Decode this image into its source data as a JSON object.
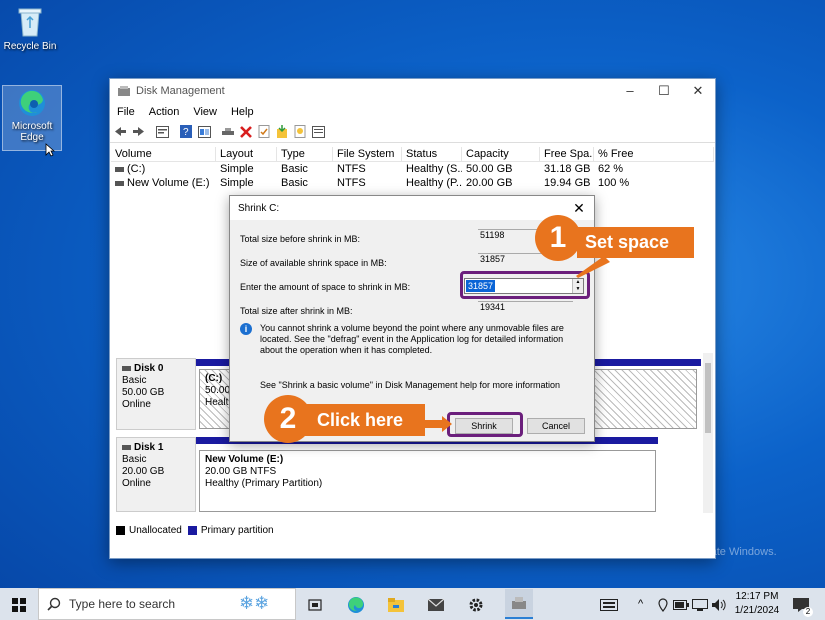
{
  "desktop": {
    "recycle_bin": "Recycle Bin",
    "edge_line1": "Microsoft",
    "edge_line2": "Edge"
  },
  "window": {
    "title": "Disk Management",
    "controls": {
      "minimize": "–",
      "maximize": "☐",
      "close": "✕"
    },
    "menu": [
      "File",
      "Action",
      "View",
      "Help"
    ],
    "toolbar_icons": [
      "back-icon",
      "forward-icon",
      "properties-icon",
      "help-icon",
      "console-icon",
      "connect-icon",
      "delete-icon",
      "check-icon",
      "import-icon",
      "search-icon",
      "list-icon"
    ]
  },
  "volume_table": {
    "headers": [
      "Volume",
      "Layout",
      "Type",
      "File System",
      "Status",
      "Capacity",
      "Free Spa...",
      "% Free"
    ],
    "rows": [
      [
        "(C:)",
        "Simple",
        "Basic",
        "NTFS",
        "Healthy (S...",
        "50.00 GB",
        "31.18 GB",
        "62 %"
      ],
      [
        "New Volume (E:)",
        "Simple",
        "Basic",
        "NTFS",
        "Healthy (P...",
        "20.00 GB",
        "19.94 GB",
        "100 %"
      ]
    ]
  },
  "disks": {
    "disk0": {
      "name": "Disk 0",
      "type": "Basic",
      "size": "50.00 GB",
      "state": "Online",
      "part_name": "(C:)",
      "part_size": "50.00 G",
      "part_status": "Healthy"
    },
    "disk1": {
      "name": "Disk 1",
      "type": "Basic",
      "size": "20.00 GB",
      "state": "Online",
      "part_name": "New Volume  (E:)",
      "part_size": "20.00 GB NTFS",
      "part_status": "Healthy (Primary Partition)"
    }
  },
  "legend": {
    "unallocated": "Unallocated",
    "primary": "Primary partition",
    "unallocated_color": "#000000",
    "primary_color": "#1a1aa0"
  },
  "dialog": {
    "title": "Shrink C:",
    "total_before_label": "Total size before shrink in MB:",
    "total_before_value": "51198",
    "available_label": "Size of available shrink space in MB:",
    "available_value": "31857",
    "enter_label": "Enter the amount of space to shrink in MB:",
    "enter_value": "31857",
    "after_label": "Total size after shrink in MB:",
    "after_value": "19341",
    "info_text": "You cannot shrink a volume beyond the point where any unmovable files are located. See the \"defrag\" event in the Application log for detailed information about the operation when it has completed.",
    "help_text": "See \"Shrink a basic volume\" in Disk Management help for more information",
    "shrink_button": "Shrink",
    "cancel_button": "Cancel"
  },
  "annotations": {
    "step1_number": "1",
    "step1_text": "Set space",
    "step2_number": "2",
    "step2_text": "Click here",
    "highlight_color": "#6b1f7c",
    "callout_color": "#e8741e"
  },
  "watermark": {
    "line1": "Activate Windows",
    "line2": "Go to Settings to activate Windows."
  },
  "taskbar": {
    "search_placeholder": "Type here to search",
    "time": "12:17 PM",
    "date": "1/21/2024",
    "notification_count": "2",
    "tray_expand": "^"
  }
}
